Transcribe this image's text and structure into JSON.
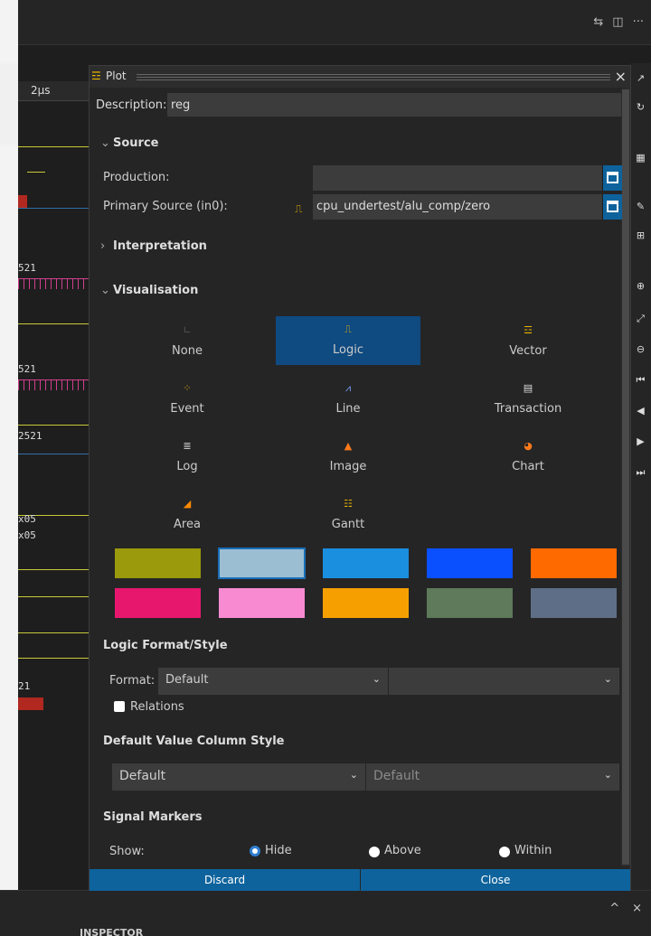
{
  "window": {
    "topbar_icons": [
      "git-compare-icon",
      "split-editor-icon",
      "more-icon"
    ],
    "topbar_more": "···"
  },
  "waveform": {
    "time_label": "2µs",
    "labels": [
      "521",
      "521",
      "2521",
      "x05",
      "x05",
      "21"
    ],
    "trace_color": "#c8c83a",
    "bus_color": "#d23f8f"
  },
  "dialog": {
    "title": "Plot",
    "close": "×",
    "description_label": "Description:",
    "description_value": "reg",
    "source": {
      "title": "Source",
      "production_label": "Production:",
      "production_value": "",
      "primary_label": "Primary Source (in0):",
      "primary_value": "cpu_undertest/alu_comp/zero"
    },
    "interpretation_title": "Interpretation",
    "visualisation": {
      "title": "Visualisation",
      "options": [
        {
          "label": "None",
          "icon": "none-icon",
          "selected": false
        },
        {
          "label": "Logic",
          "icon": "logic-icon",
          "selected": true
        },
        {
          "label": "Vector",
          "icon": "vector-icon",
          "selected": false
        },
        {
          "label": "Event",
          "icon": "event-icon",
          "selected": false
        },
        {
          "label": "Line",
          "icon": "line-icon",
          "selected": false
        },
        {
          "label": "Transaction",
          "icon": "transaction-icon",
          "selected": false
        },
        {
          "label": "Log",
          "icon": "log-icon",
          "selected": false
        },
        {
          "label": "Image",
          "icon": "image-icon",
          "selected": false
        },
        {
          "label": "Chart",
          "icon": "chart-icon",
          "selected": false
        },
        {
          "label": "Area",
          "icon": "area-icon",
          "selected": false
        },
        {
          "label": "Gantt",
          "icon": "gantt-icon",
          "selected": false
        }
      ],
      "swatches": [
        "#9a9a0c",
        "#9cbed3",
        "#1a8fe0",
        "#0a50ff",
        "#ff6a00",
        "#e8176e",
        "#f78ad0",
        "#f5a000",
        "#5e7a5a",
        "#5e6e86"
      ],
      "selected_swatch": "#9cbed3"
    },
    "logic_format": {
      "title": "Logic Format/Style",
      "format_label": "Format:",
      "format_value": "Default",
      "style_value": "",
      "relations_label": "Relations"
    },
    "value_column": {
      "title": "Default Value Column Style",
      "left_value": "Default",
      "right_value": "Default"
    },
    "markers": {
      "title": "Signal Markers",
      "show_label": "Show:",
      "options": [
        "Hide",
        "Above",
        "Within"
      ],
      "selected": "Hide"
    },
    "buttons": {
      "discard": "Discard",
      "close": "Close"
    }
  },
  "bottom": {
    "panel_title": "INSPECTOR",
    "controls": [
      "^",
      "×"
    ]
  }
}
